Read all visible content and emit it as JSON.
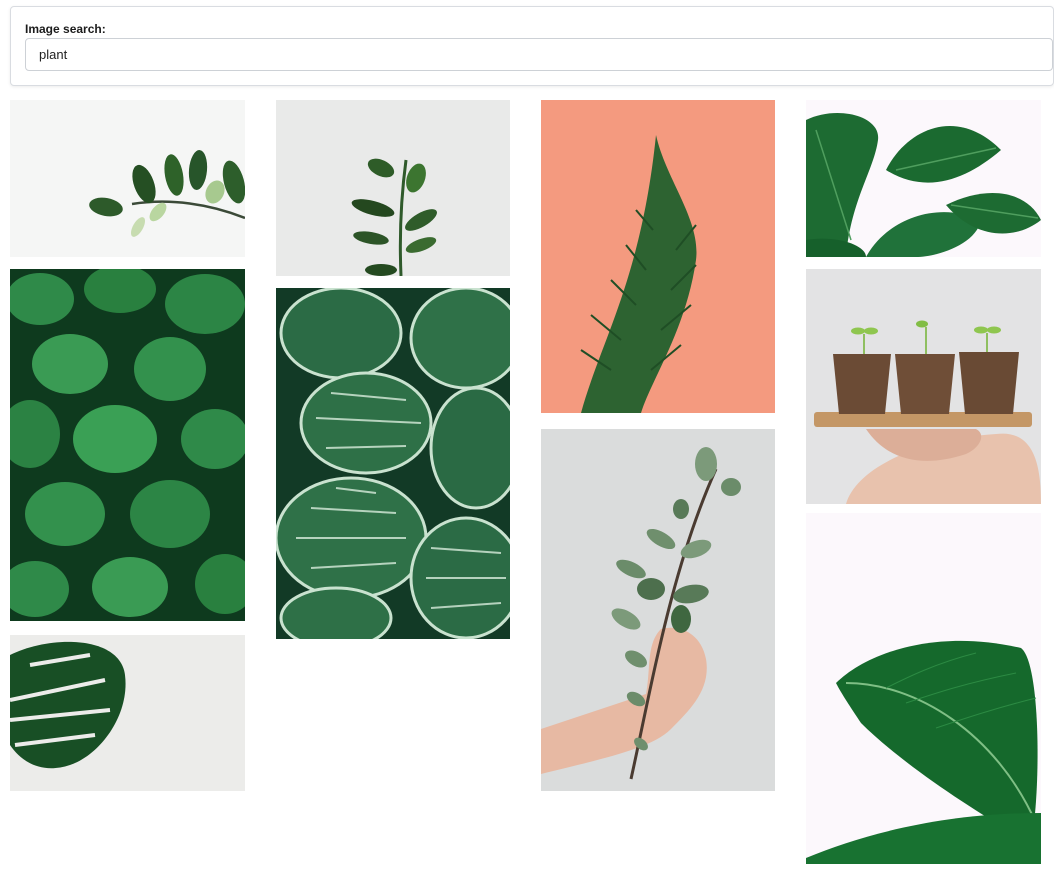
{
  "search": {
    "label": "Image search:",
    "value": "plant",
    "placeholder": ""
  },
  "images": [
    {
      "subject": "zz-plant-sprig-on-white"
    },
    {
      "subject": "dense-green-leaves"
    },
    {
      "subject": "monstera-leaf-corner"
    },
    {
      "subject": "young-stem-on-white"
    },
    {
      "subject": "calathea-orbifolia-leaves"
    },
    {
      "subject": "conifer-branch-on-coral"
    },
    {
      "subject": "eucalyptus-stem-in-hand"
    },
    {
      "subject": "peace-lily-leaves"
    },
    {
      "subject": "seedlings-in-pots-on-tray"
    },
    {
      "subject": "large-leaf-on-white"
    }
  ]
}
